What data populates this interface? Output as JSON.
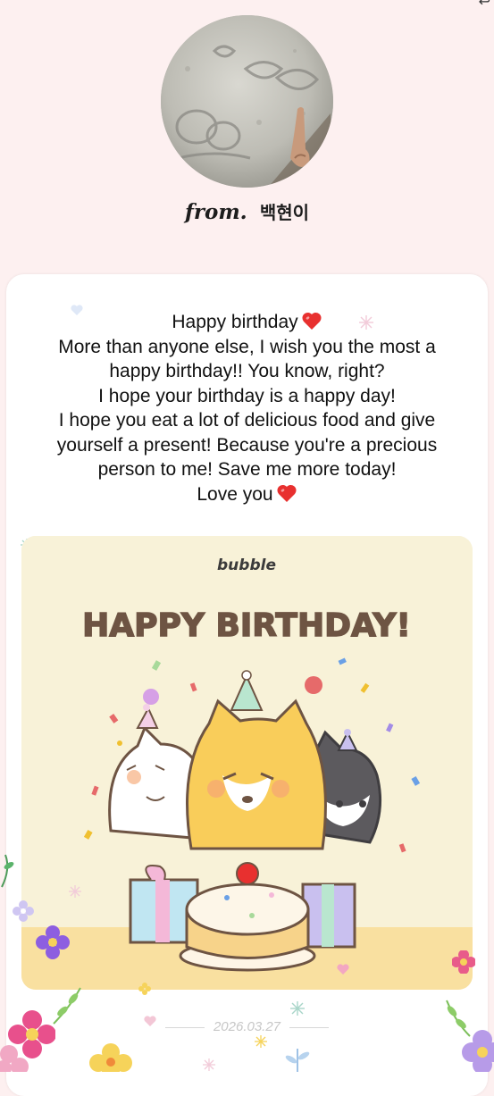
{
  "sender": {
    "from_label": "from.",
    "name": "백현이"
  },
  "message": {
    "lines": [
      "Happy birthday",
      "More than anyone else, I wish you the most a",
      "happy birthday!! You know, right?",
      "I hope your birthday is a happy day!",
      "I hope you eat a lot of delicious food and give",
      "yourself a present! Because you're a precious",
      "person to me! Save me more today!",
      "Love you"
    ]
  },
  "birthday_card": {
    "brand": "bubble",
    "headline": "HAPPY BIRTHDAY!"
  },
  "date": "2026.03.27",
  "colors": {
    "page_background": "#fdf0f0",
    "card_background": "#ffffff",
    "heart": "#e8302f",
    "birthday_card_background": "#f8f2d8",
    "headline": "#6e5443"
  },
  "icons": {
    "heart": "heart-emoji-icon",
    "corner": "share-arrow-icon"
  }
}
